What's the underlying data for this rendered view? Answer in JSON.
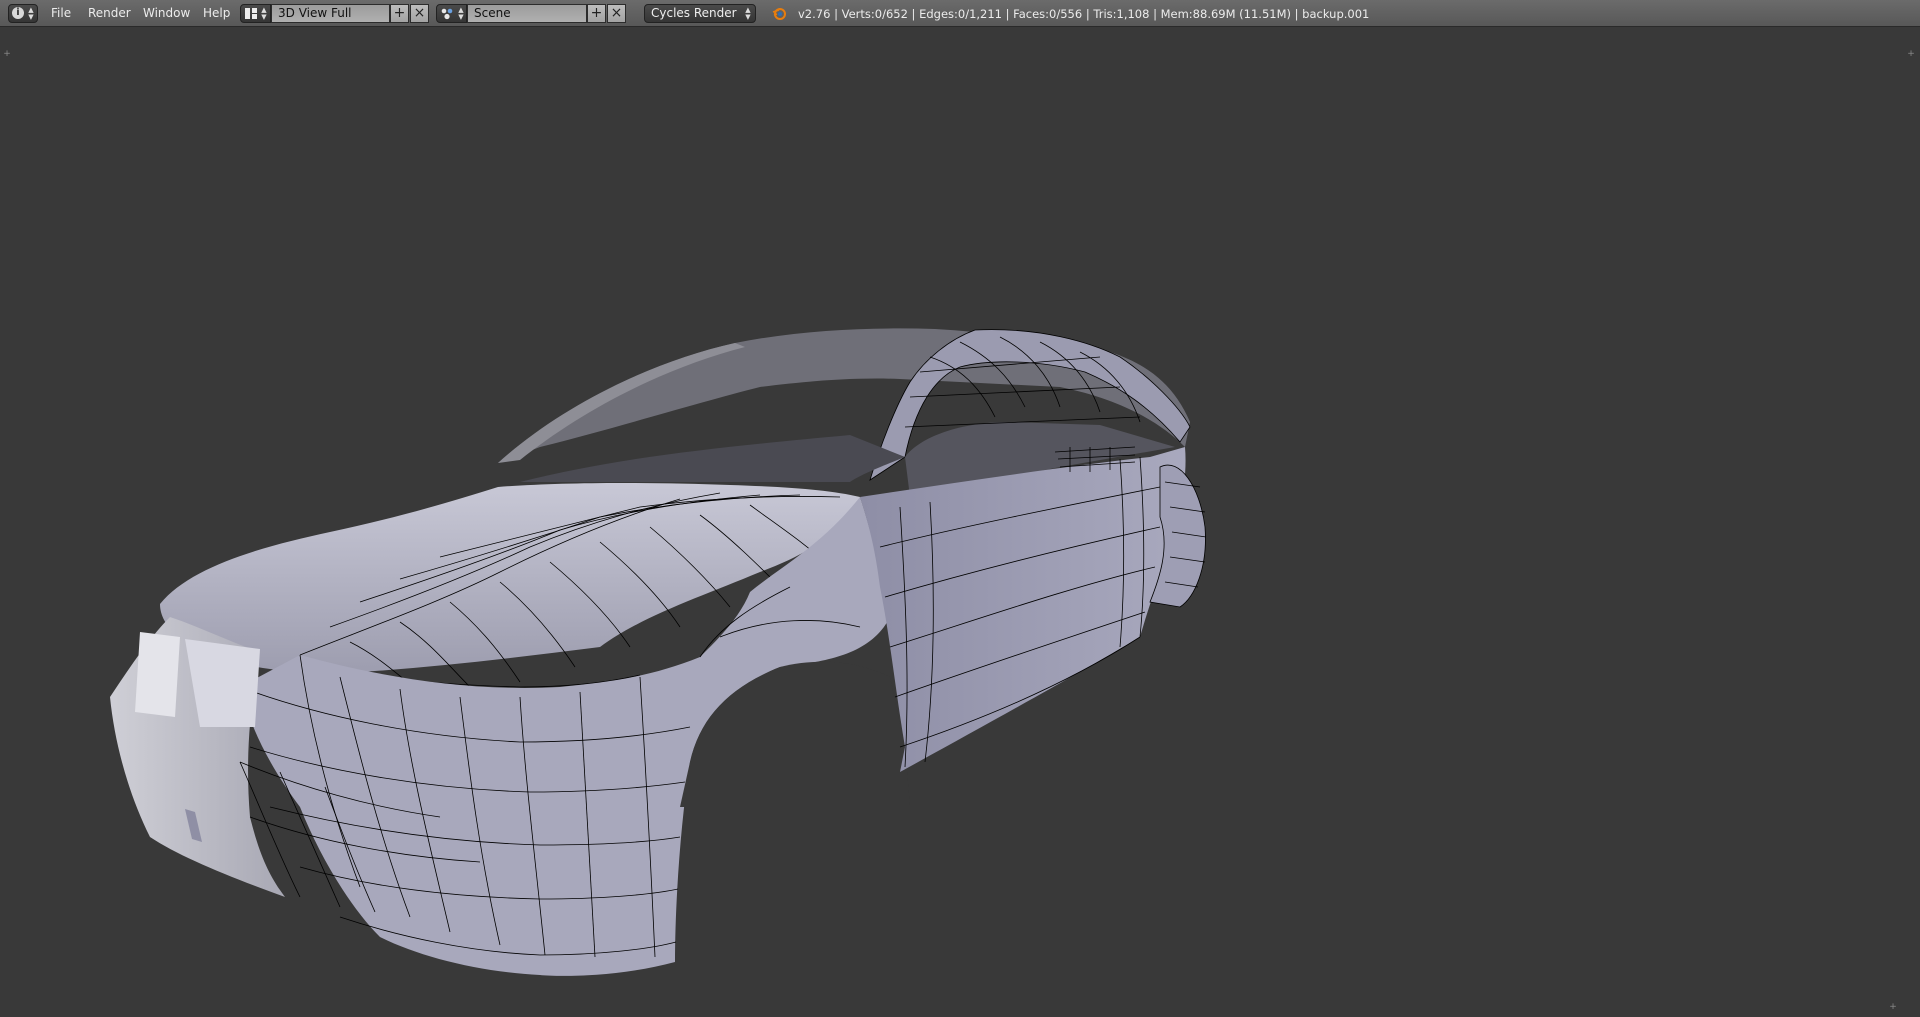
{
  "header": {
    "menus": [
      "File",
      "Render",
      "Window",
      "Help"
    ],
    "screen_layout": "3D View Full",
    "scene": "Scene",
    "render_engine": "Cycles Render",
    "stats": "v2.76 | Verts:0/652 | Edges:0/1,211 | Faces:0/556 | Tris:1,108 | Mem:88.69M (11.51M) | backup.001",
    "add_symbol": "+",
    "close_symbol": "×"
  },
  "icons": {
    "editor_type": "info-icon",
    "screen_layout": "screen-layout-icon",
    "scene": "scene-icon",
    "logo": "blender-logo-icon"
  },
  "colors": {
    "header_bg": "#606060",
    "viewport_bg": "#393939",
    "mesh_surface": "#b8b8c8",
    "mesh_wire": "#000000",
    "blender_orange": "#e87d0d"
  }
}
